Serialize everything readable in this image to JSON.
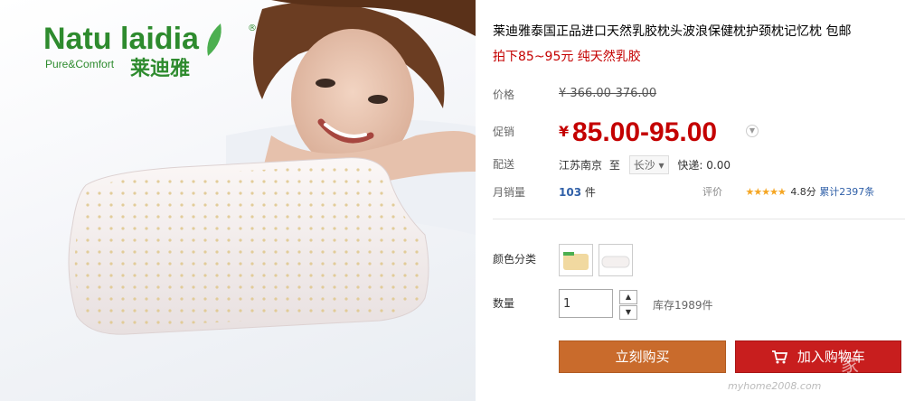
{
  "logo": {
    "brand": "Natu laidi",
    "brand_end": "a",
    "reg": "®",
    "tagline": "Pure&Comfort",
    "cn": "莱迪雅"
  },
  "product": {
    "title": "莱迪雅泰国正品进口天然乳胶枕头波浪保健枕护颈枕记忆枕 包邮",
    "subtitle": "拍下85~95元 纯天然乳胶"
  },
  "price": {
    "label": "价格",
    "symbol": "¥",
    "original": "366.00-376.00"
  },
  "promo": {
    "label": "促销",
    "symbol": "¥",
    "value": "85.00-95.00"
  },
  "shipping": {
    "label": "配送",
    "from": "江苏南京",
    "to_word": "至",
    "to_city": "长沙",
    "fee": "快递: 0.00"
  },
  "sales": {
    "label": "月销量",
    "count": "103",
    "unit": "件",
    "rating_label": "评价",
    "stars": "★★★★★",
    "score": "4.8分",
    "review_count": "累计2397条"
  },
  "color": {
    "label": "颜色分类"
  },
  "quantity": {
    "label": "数量",
    "value": "1",
    "stock": "库存1989件"
  },
  "actions": {
    "buy": "立刻购买",
    "cart": "加入购物车"
  },
  "watermark": {
    "text": "家",
    "url": "myhome2008.com"
  },
  "colors": {
    "accent_red": "#c40000",
    "buy_orange": "#c96b2c",
    "cart_red": "#c81e1e",
    "brand_green": "#2e8b2e"
  }
}
